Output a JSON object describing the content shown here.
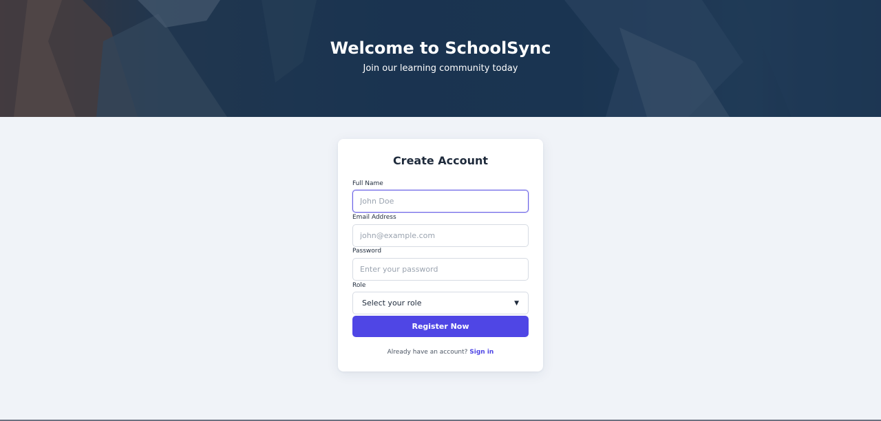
{
  "hero": {
    "title": "Welcome to SchoolSync",
    "subtitle": "Join our learning community today"
  },
  "form": {
    "title": "Create Account",
    "full_name": {
      "label": "Full Name",
      "placeholder": "John Doe",
      "value": ""
    },
    "email": {
      "label": "Email Address",
      "placeholder": "john@example.com",
      "value": ""
    },
    "password": {
      "label": "Password",
      "placeholder": "Enter your password",
      "value": ""
    },
    "role": {
      "label": "Role",
      "selected": "Select your role"
    },
    "submit_label": "Register Now",
    "footer_text": "Already have an account?",
    "signin_label": "Sign in"
  },
  "colors": {
    "accent": "#4f46e5",
    "page_bg": "#f0f3f8",
    "hero_overlay": "#1f3a55"
  }
}
